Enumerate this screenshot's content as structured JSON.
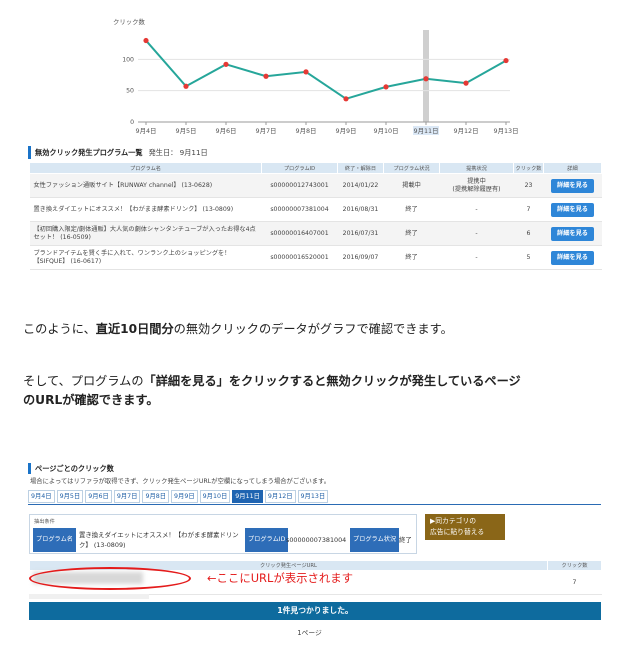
{
  "chart_data": {
    "type": "line",
    "ylabel": "クリック数",
    "y_ticks": [
      "0",
      "50",
      "100"
    ],
    "ylim": [
      0,
      150
    ],
    "categories": [
      "9月4日",
      "9月5日",
      "9月6日",
      "9月7日",
      "9月8日",
      "9月9日",
      "9月10日",
      "9月11日",
      "9月12日",
      "9月13日"
    ],
    "series": [
      {
        "values": [
          130,
          57,
          92,
          73,
          80,
          37,
          56,
          69,
          62,
          98
        ]
      }
    ],
    "highlight_category": "9月11日",
    "line_color": "#26a69a",
    "point_color": "#e53935",
    "highlight_color": "#cfcfcf"
  },
  "section1": {
    "title": "無効クリック発生プログラム一覧",
    "date_label": "発生日： 9月11日",
    "columns": [
      "プログラム名",
      "プログラムID",
      "終了・解除日",
      "プログラム状況",
      "提携状況",
      "クリック数",
      "詳細"
    ],
    "rows": [
      {
        "name": "女性ファッション通販サイト【RUNWAY channel】 (13-0628)",
        "id": "s00000012743001",
        "end": "2014/01/22",
        "status": "掲載中",
        "partner": "提携中\n(提携解除履歴有)",
        "clicks": "23",
        "btn": "詳細を見る"
      },
      {
        "name": "置き換えダイエットにオススメ！【わがまま酵素ドリンク】 (13-0809)",
        "id": "s00000007381004",
        "end": "2016/08/31",
        "status": "終了",
        "partner": "-",
        "clicks": "7",
        "btn": "詳細を見る"
      },
      {
        "name": "【初回購入限定/劇体通販】大人気の劇体シャンタンチューブが入ったお得な4点セット！ (16-0509)",
        "id": "s00000016407001",
        "end": "2016/07/31",
        "status": "終了",
        "partner": "-",
        "clicks": "6",
        "btn": "詳細を見る"
      },
      {
        "name": "ブランドアイテムを賢く手に入れて、ワンランク上のショッピングを！【SIFQUE】 (16-0617)",
        "id": "s00000016520001",
        "end": "2016/09/07",
        "status": "終了",
        "partner": "-",
        "clicks": "5",
        "btn": "詳細を見る"
      }
    ]
  },
  "prose": {
    "p1_a": "このように、",
    "p1_b": "直近10日間分",
    "p1_c": "の無効クリックのデータがグラフで確認できます。",
    "p2_a": "そして、プログラムの",
    "p2_b": "「詳細を見る」をクリックすると無効クリックが発生しているページ",
    "p2_c": "のURLが確認できます。"
  },
  "section2": {
    "title": "ページごとのクリック数",
    "note": "場合によってはリファラが取得できず、クリック発生ページURLが空欄になってしまう場合がございます。",
    "date_tabs": [
      "9月4日",
      "9月5日",
      "9月6日",
      "9月7日",
      "9月8日",
      "9月9日",
      "9月10日",
      "9月11日",
      "9月12日",
      "9月13日"
    ],
    "active_tab": 7,
    "filter_title": "抽出条件",
    "filter_program_label": "プログラム名",
    "filter_program_value": "置き換えダイエットにオススメ！【わがまま酵素ドリンク】 (13-0809)",
    "filter_id_label": "プログラムID",
    "filter_id_value": "s00000007381004",
    "filter_status_label": "プログラム状況",
    "filter_status_value": "終了",
    "category_button": "▶同カテゴリの\n広告に貼り替える",
    "table_columns": [
      "クリック発生ページURL",
      "クリック数"
    ],
    "table_row_clicks": "7",
    "annotation": "←ここにURLが表示されます",
    "result": "1件見つかりました。",
    "page_info": "1ページ"
  }
}
